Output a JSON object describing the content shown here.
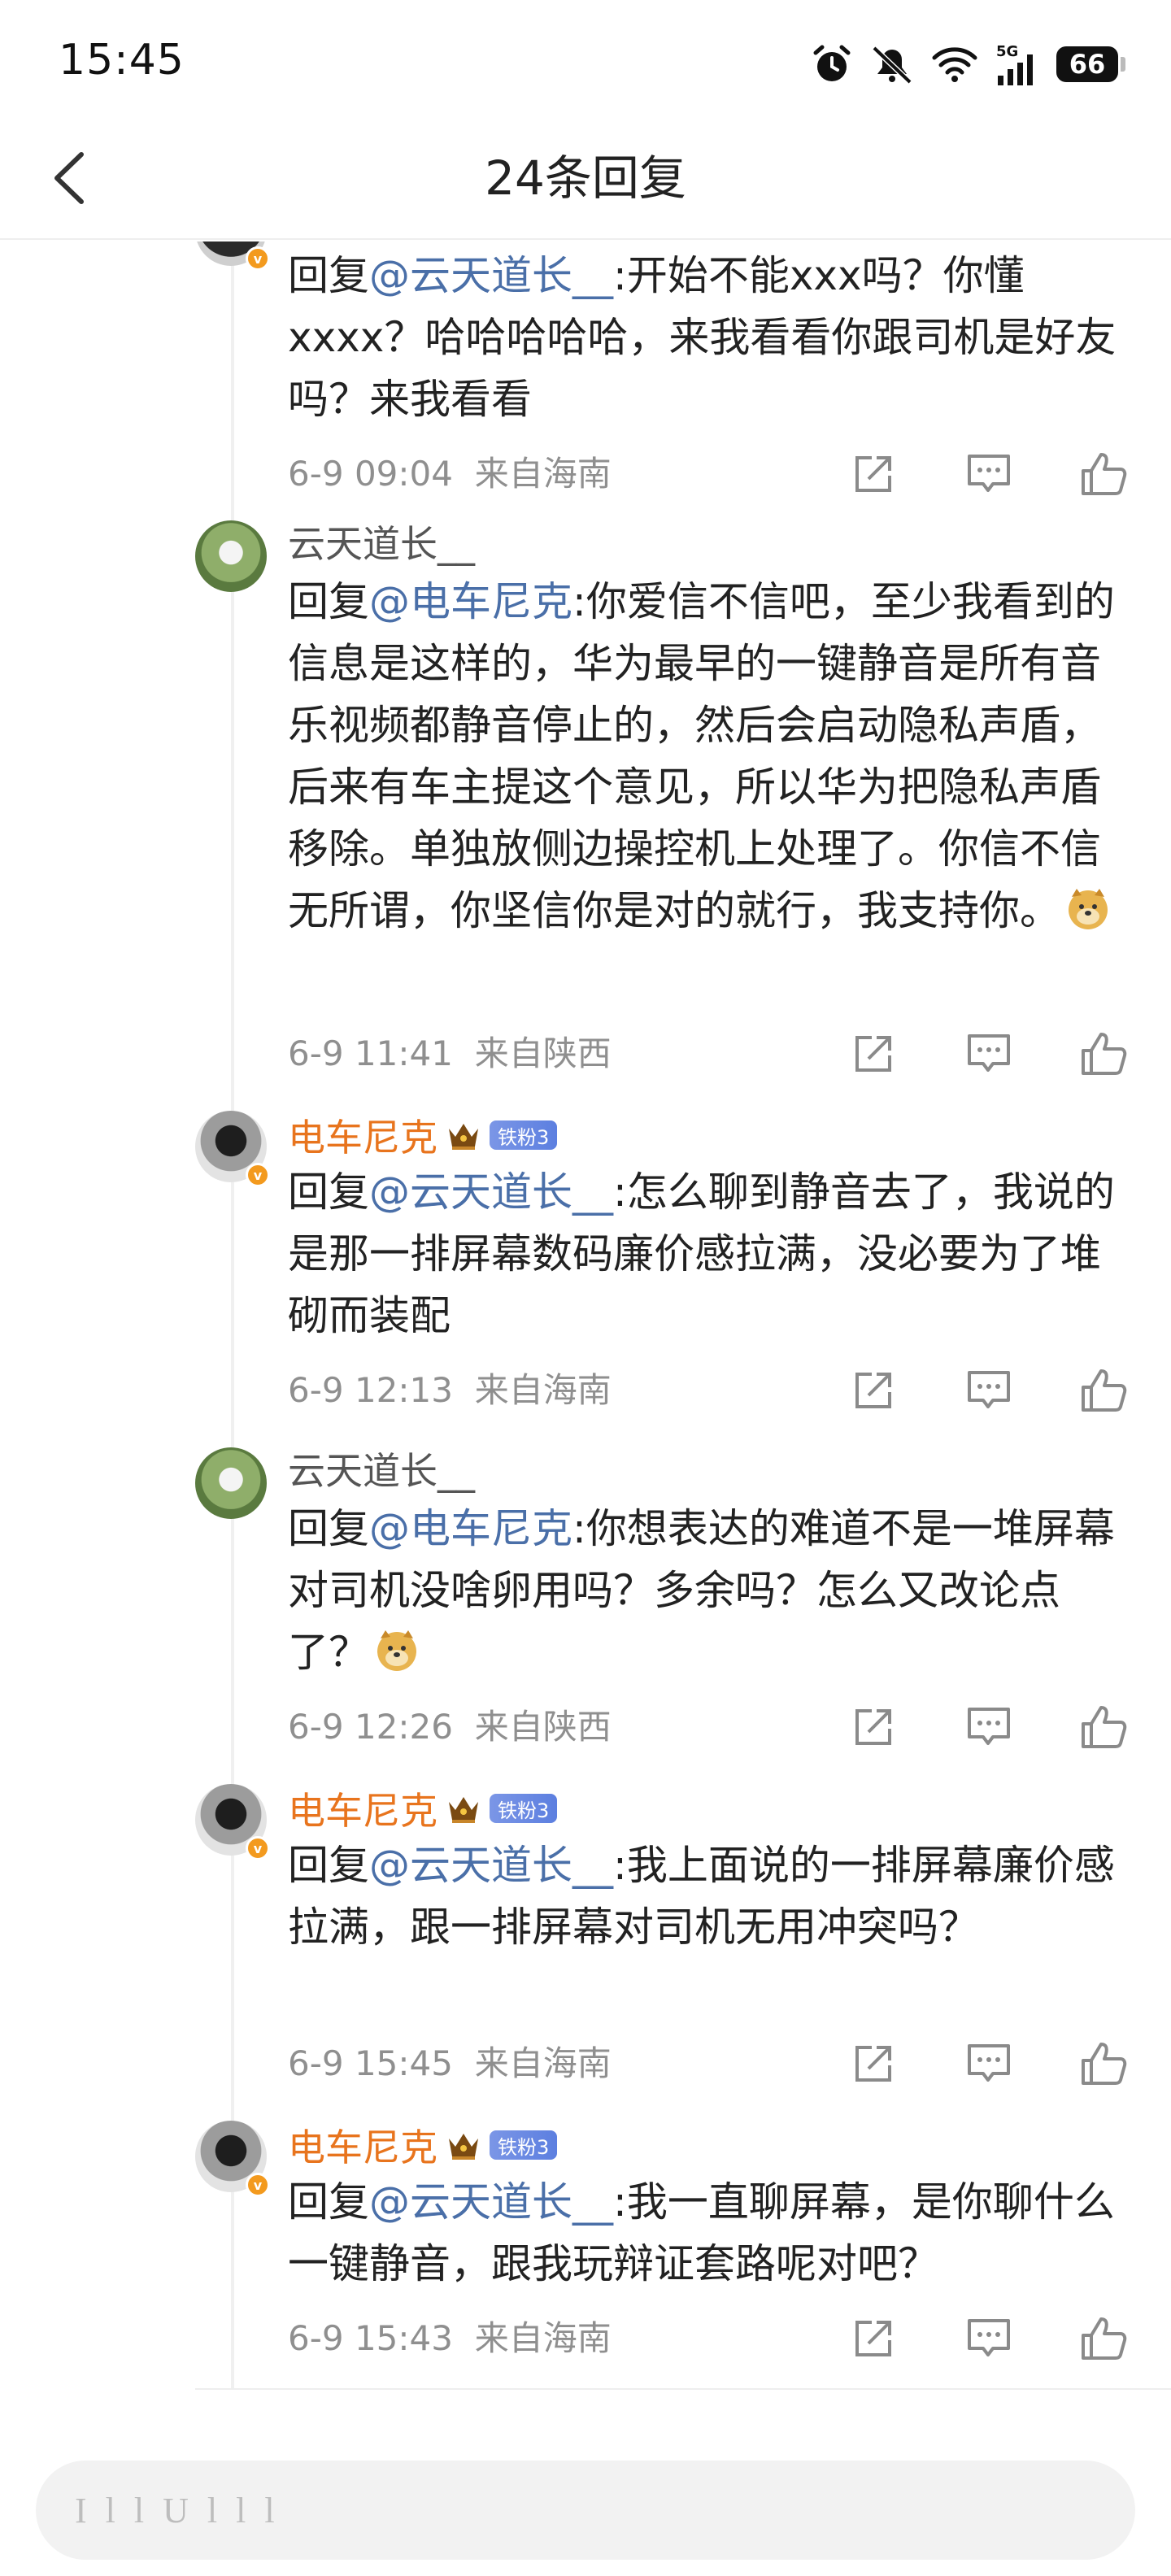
{
  "status_bar": {
    "time": "15:45",
    "network": "5G",
    "battery": "66"
  },
  "header": {
    "title": "24条回复"
  },
  "replies": [
    {
      "author": "",
      "prefix": "回复",
      "mention": "@云天道长__",
      "content": ":开始不能xxx吗？你懂xxxx？哈哈哈哈哈，来我看看你跟司机是好友吗？来我看看",
      "time": "6-9 09:04",
      "location": "来自海南"
    },
    {
      "author": "云天道长__",
      "prefix": "回复",
      "mention": "@电车尼克",
      "content": ":你爱信不信吧，至少我看到的信息是这样的，华为最早的一键静音是所有音乐视频都静音停止的，然后会启动隐私声盾，后来有车主提这个意见，所以华为把隐私声盾移除。单独放侧边操控机上处理了。你信不信无所谓，你坚信你是对的就行，我支持你。",
      "time": "6-9 11:41",
      "location": "来自陕西"
    },
    {
      "author": "电车尼克",
      "fan_badge": "铁粉3",
      "prefix": "回复",
      "mention": "@云天道长__",
      "content": ":怎么聊到静音去了，我说的是那一排屏幕数码廉价感拉满，没必要为了堆砌而装配",
      "time": "6-9 12:13",
      "location": "来自海南"
    },
    {
      "author": "云天道长__",
      "prefix": "回复",
      "mention": "@电车尼克",
      "content": ":你想表达的难道不是一堆屏幕对司机没啥卵用吗？多余吗？怎么又改论点了？",
      "time": "6-9 12:26",
      "location": "来自陕西"
    },
    {
      "author": "电车尼克",
      "fan_badge": "铁粉3",
      "prefix": "回复",
      "mention": "@云天道长__",
      "content": ":我上面说的一排屏幕廉价感拉满，跟一排屏幕对司机无用冲突吗？",
      "time": "6-9 15:45",
      "location": "来自海南"
    },
    {
      "author": "电车尼克",
      "fan_badge": "铁粉3",
      "prefix": "回复",
      "mention": "@云天道长__",
      "content": ":我一直聊屏幕，是你聊什么一键静音，跟我玩辩证套路呢对吧？",
      "time": "6-9 15:43",
      "location": "来自海南"
    }
  ],
  "input": {
    "placeholder": "I l l U  l l l"
  },
  "colors": {
    "mention": "#4a6fa8",
    "vip_name": "#e8741d",
    "meta": "#8f8f8f",
    "fan_badge": "#6d8ae4"
  },
  "icons": [
    "back-arrow-icon",
    "alarm-icon",
    "mute-icon",
    "wifi-icon",
    "signal-icon",
    "battery-icon",
    "share-icon",
    "comment-icon",
    "like-icon",
    "crown-icon",
    "doge-emoji-icon"
  ]
}
